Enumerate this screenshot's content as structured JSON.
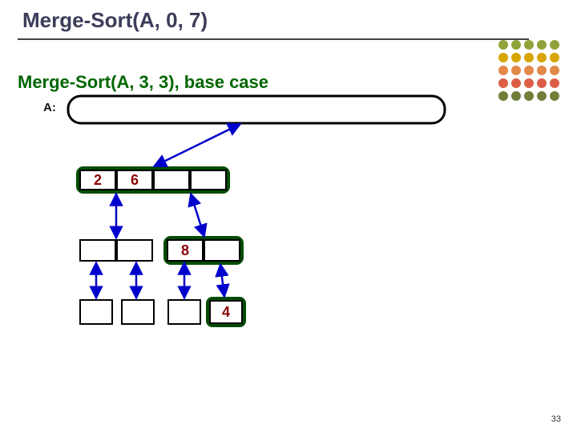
{
  "title": "Merge-Sort(A, 0, 7)",
  "subtitle": "Merge-Sort(A, 3, 3), base case",
  "array_label": "A:",
  "page_number": "33",
  "dot_colors": [
    "#8fa33a",
    "#d6a500",
    "#e2894a",
    "#dd5e47",
    "#6f7f3a"
  ],
  "values": {
    "level1_cell0": "2",
    "level1_cell1": "6",
    "level2_cell0": "8",
    "level3_cell1": "4"
  }
}
